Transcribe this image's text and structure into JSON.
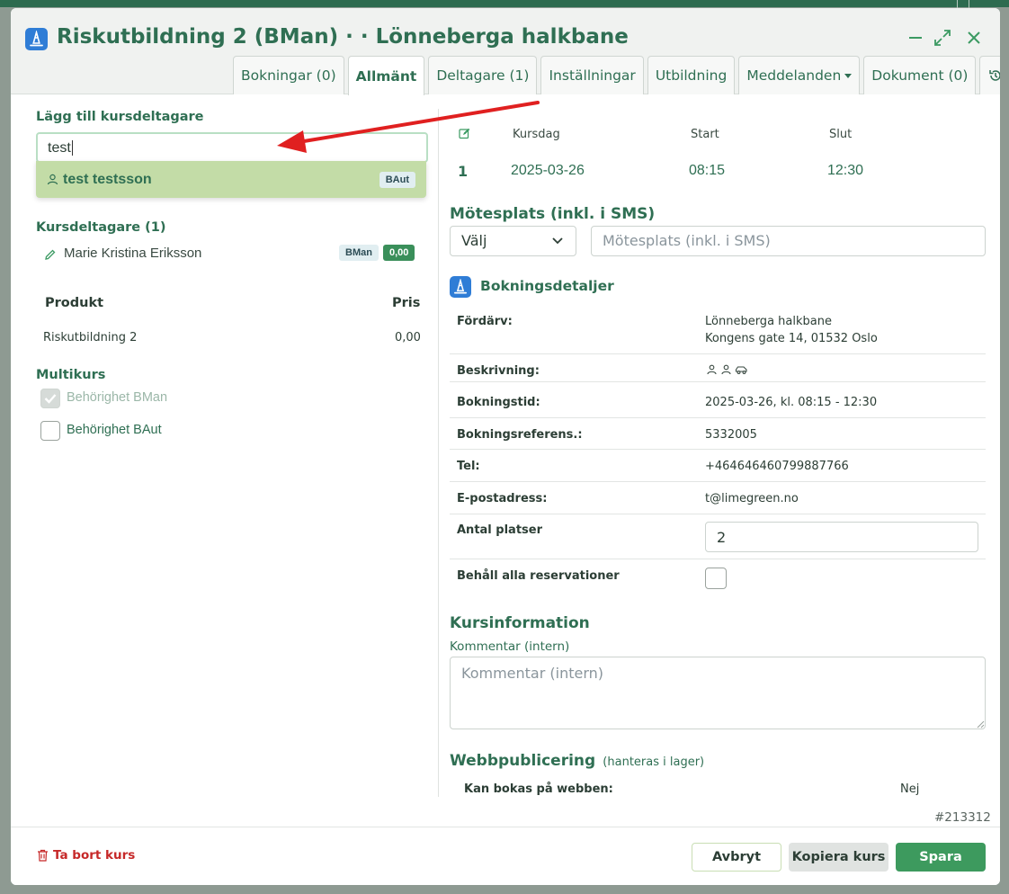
{
  "window": {
    "title": "Riskutbildning 2 (BMan) · · Lönneberga halkbane",
    "controls": {
      "minimize_icon": "minus-icon",
      "maximize_icon": "expand-icon",
      "close_icon": "close-icon"
    }
  },
  "tabs": [
    {
      "label": "Bokningar (0)",
      "active": false
    },
    {
      "label": "Allmänt",
      "active": true
    },
    {
      "label": "Deltagare (1)",
      "active": false
    },
    {
      "label": "Inställningar",
      "active": false
    },
    {
      "label": "Utbildning",
      "active": false
    },
    {
      "label": "Meddelanden",
      "active": false,
      "dropdown": true
    },
    {
      "label": "Dokument (0)",
      "active": false
    }
  ],
  "left": {
    "add_participant_label": "Lägg till kursdeltagare",
    "search_value": "test",
    "suggestion": {
      "name": "test testsson",
      "badge": "BAut"
    },
    "participants_header": "Kursdeltagare (1)",
    "participant": {
      "name": "Marie Kristina Eriksson",
      "badge": "BMan",
      "amount": "0,00"
    },
    "product_table": {
      "headers": [
        "Produkt",
        "Pris"
      ],
      "rows": [
        {
          "product": "Riskutbildning 2",
          "price": "0,00"
        }
      ]
    },
    "multikurs": {
      "header": "Multikurs",
      "options": [
        {
          "label": "Behörighet BMan",
          "checked": true,
          "disabled": true
        },
        {
          "label": "Behörighet BAut",
          "checked": false,
          "disabled": false
        }
      ]
    }
  },
  "schedule": {
    "headers": [
      "Kursdag",
      "Start",
      "Slut"
    ],
    "rows": [
      {
        "num": "1",
        "date": "2025-03-26",
        "start": "08:15",
        "end": "12:30"
      }
    ]
  },
  "meeting": {
    "header": "Mötesplats (inkl. i SMS)",
    "select_value": "Välj",
    "input_placeholder": "Mötesplats (inkl. i SMS)"
  },
  "booking": {
    "header": "Bokningsdetaljer",
    "rows": [
      {
        "label": "Fördärv:",
        "value": "Lönneberga halkbane",
        "value2": "Kongens gate 14, 01532 Oslo"
      },
      {
        "label": "Beskrivning:",
        "value": ""
      },
      {
        "label": "Bokningstid:",
        "value": "2025-03-26, kl. 08:15 - 12:30"
      },
      {
        "label": "Bokningsreferens.:",
        "value": "5332005"
      },
      {
        "label": "Tel:",
        "value": "+464646460799887766"
      },
      {
        "label": "E-postadress:",
        "value": "t@limegreen.no"
      },
      {
        "label": "Antal platser",
        "value": "2"
      },
      {
        "label": "Behåll alla reservationer",
        "value": ""
      }
    ]
  },
  "course_info": {
    "header": "Kursinformation",
    "comment_label": "Kommentar (intern)",
    "comment_placeholder": "Kommentar (intern)"
  },
  "web": {
    "header": "Webbpublicering",
    "subheader": "(hanteras i lager)",
    "bookable_label": "Kan bokas på webben:",
    "bookable_value": "Nej"
  },
  "id_text": "#213312",
  "footer": {
    "delete": "Ta bort kurs",
    "cancel": "Avbryt",
    "copy": "Kopiera kurs",
    "save": "Spara"
  },
  "colors": {
    "brand": "#2f6f53",
    "save": "#3d9a5e",
    "suggest_bg": "#c3dca7",
    "annotation_arrow": "#e02020"
  }
}
